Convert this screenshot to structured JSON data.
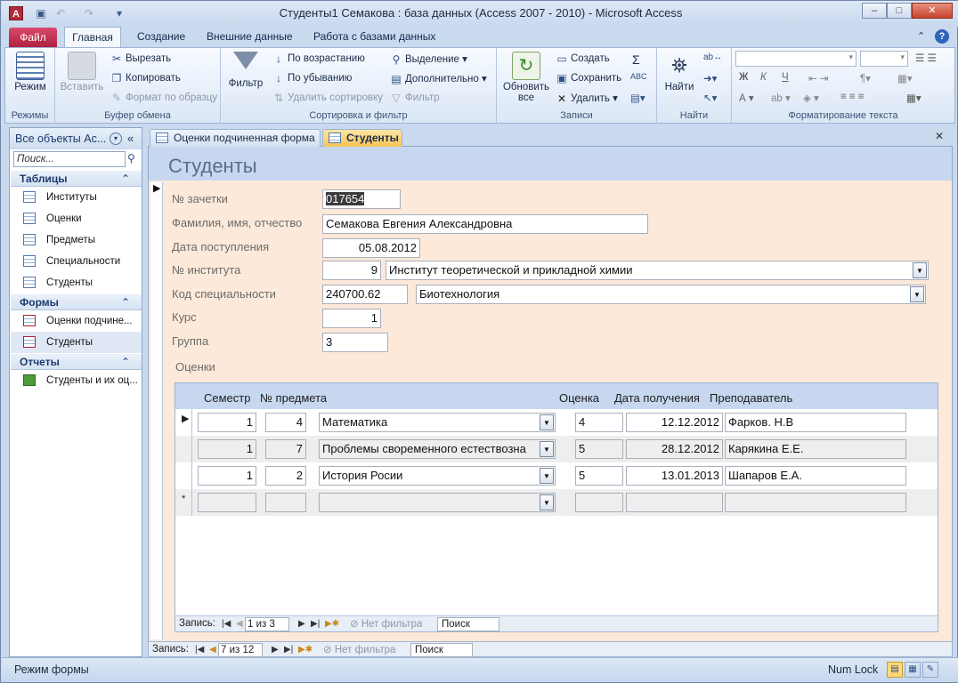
{
  "window": {
    "title": "Студенты1 Семакова : база данных (Access 2007 - 2010)  -  Microsoft Access",
    "app_icon": "A",
    "controls": {
      "minimize": "–",
      "maximize": "□",
      "close": "✕"
    }
  },
  "qat": {
    "save_icon": "save-icon",
    "undo_icon": "undo-icon",
    "redo_icon": "redo-icon"
  },
  "ribbon_tabs": [
    "Файл",
    "Главная",
    "Создание",
    "Внешние данные",
    "Работа с базами данных"
  ],
  "ribbon": {
    "views": {
      "button": "Режим",
      "group": "Режимы"
    },
    "clipboard": {
      "paste": "Вставить",
      "cut": "Вырезать",
      "copy": "Копировать",
      "format_painter": "Формат по образцу",
      "group": "Буфер обмена"
    },
    "sort_filter": {
      "filter": "Фильтр",
      "ascending": "По возрастанию",
      "descending": "По убыванию",
      "remove_sort": "Удалить сортировку",
      "selection": "Выделение",
      "advanced": "Дополнительно",
      "toggle_filter": "Фильтр",
      "group": "Сортировка и фильтр"
    },
    "records": {
      "refresh": "Обновить",
      "refresh_sub": "все",
      "new": "Создать",
      "save": "Сохранить",
      "delete": "Удалить",
      "totals": "Σ",
      "group": "Записи"
    },
    "find": {
      "find": "Найти",
      "group": "Найти"
    },
    "text_format": {
      "bold": "Ж",
      "italic": "К",
      "underline": "Ч",
      "font_color": "А",
      "group": "Форматирование текста"
    }
  },
  "nav_pane": {
    "title": "Все объекты Ac...",
    "search_placeholder": "Поиск...",
    "sections": [
      {
        "title": "Таблицы",
        "items": [
          "Институты",
          "Оценки",
          "Предметы",
          "Специальности",
          "Студенты"
        ]
      },
      {
        "title": "Формы",
        "items": [
          "Оценки подчине...",
          "Студенты"
        ]
      },
      {
        "title": "Отчеты",
        "items": [
          "Студенты и их оц..."
        ]
      }
    ]
  },
  "doc_tabs": [
    "Оценки подчиненная форма",
    "Студенты"
  ],
  "form": {
    "title": "Студенты",
    "fields": [
      {
        "label": "№ зачетки",
        "value": "017654"
      },
      {
        "label": "Фамилия, имя, отчество",
        "value": "Семакова Евгения Александровна"
      },
      {
        "label": "Дата поступления",
        "value": "05.08.2012"
      },
      {
        "label": "№ института",
        "value": "9",
        "combo_value": "Институт теоретической и прикладной химии"
      },
      {
        "label": "Код специальности",
        "value": "240700.62",
        "combo_value": "Биотехнология"
      },
      {
        "label": "Курс",
        "value": "1"
      },
      {
        "label": "Группа",
        "value": "3"
      }
    ],
    "subform_label": "Оценки"
  },
  "subform": {
    "columns": [
      "Семестр",
      "№ предмета",
      "Оценка",
      "Дата получения",
      "Преподаватель"
    ],
    "rows": [
      {
        "semester": "1",
        "subject_no": "4",
        "subject": "Математика",
        "grade": "4",
        "date": "12.12.2012",
        "teacher": "Фарков. Н.В"
      },
      {
        "semester": "1",
        "subject_no": "7",
        "subject": "Проблемы своременного естествозна",
        "grade": "5",
        "date": "28.12.2012",
        "teacher": "Карякина Е.Е."
      },
      {
        "semester": "1",
        "subject_no": "2",
        "subject": "История Росии",
        "grade": "5",
        "date": "13.01.2013",
        "teacher": "Шапаров Е.А."
      }
    ],
    "new_row_marker": "*",
    "record_nav": {
      "label": "Запись:",
      "counter": "1 из 3",
      "filter": "Нет фильтра",
      "search": "Поиск"
    }
  },
  "main_record_nav": {
    "label": "Запись:",
    "counter": "7 из 12",
    "filter": "Нет фильтра",
    "search": "Поиск"
  },
  "status_bar": {
    "mode": "Режим формы",
    "num_lock": "Num Lock"
  }
}
